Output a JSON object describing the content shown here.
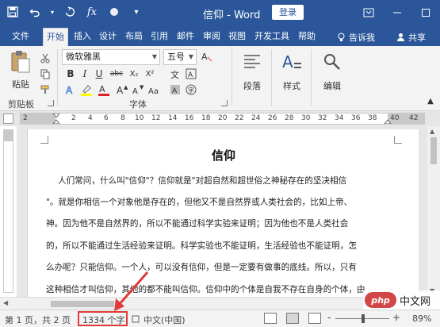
{
  "window": {
    "title": "信仰 - Word",
    "login_label": "登录"
  },
  "quick_access": {
    "icons": [
      "save-icon",
      "undo-icon",
      "redo-icon",
      "formula-icon",
      "format-painter-icon",
      "customize-icon"
    ]
  },
  "tabs": [
    {
      "label": "文件"
    },
    {
      "label": "开始"
    },
    {
      "label": "插入"
    },
    {
      "label": "设计"
    },
    {
      "label": "布局"
    },
    {
      "label": "引用"
    },
    {
      "label": "邮件"
    },
    {
      "label": "审阅"
    },
    {
      "label": "视图"
    },
    {
      "label": "开发工具"
    },
    {
      "label": "帮助"
    }
  ],
  "tell_me": "告诉我",
  "share": "共享",
  "ribbon": {
    "clipboard": {
      "paste_label": "粘贴",
      "group_label": "剪贴板"
    },
    "font": {
      "font_name": "微软雅黑",
      "font_size": "五号",
      "group_label": "字体",
      "format_buttons": [
        "B",
        "I",
        "U",
        "abc",
        "X₂",
        "X²"
      ],
      "font_color": "#e02020",
      "highlight_color": "#ffff00"
    },
    "paragraph": {
      "label": "段落"
    },
    "styles": {
      "label": "样式"
    },
    "editing": {
      "label": "编辑"
    }
  },
  "ruler": {
    "labels": [
      "2",
      "2",
      "4",
      "6",
      "8",
      "10",
      "12",
      "14",
      "16",
      "18",
      "20",
      "22",
      "24",
      "26",
      "28",
      "30",
      "32",
      "34",
      "36",
      "38",
      "40",
      "42"
    ]
  },
  "document": {
    "title": "信仰",
    "lines": [
      "人们常问，什么叫\"信仰\"？信仰就是\"对超自然和超世俗之神秘存在的坚决相信",
      "\"。就是你相信一个对象他是存在的，但他又不是自然界或人类社会的，比如上帝、",
      "神。因为他不是自然界的，所以不能通过科学实验来证明；因为他也不是人类社会",
      "的，所以不能通过生活经验来证明。科学实验也不能证明，生活经验也不能证明，怎",
      "么办呢？只能信仰。一个人，可以没有信仰，但是一定要有做事的底线。所以，只有",
      "这种相信才叫信仰，其他的都不能叫信仰。信仰中的个体是自我不存在自身的个体，由"
    ]
  },
  "status": {
    "page": "第 1 页，共 2 页",
    "word_count": "1334 个字",
    "language": "中文(中国)",
    "zoom": "89%",
    "zoom_minus": "-",
    "zoom_plus": "+"
  },
  "watermark": {
    "logo": "php",
    "text": "中文网"
  },
  "colors": {
    "accent": "#2b579a",
    "annotation": "#e03a3a"
  }
}
